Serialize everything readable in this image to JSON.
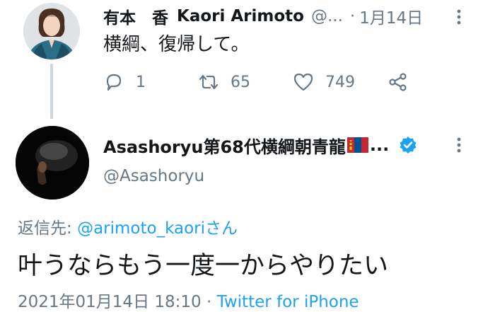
{
  "parent_tweet": {
    "avatar_icon": "profile-photo-woman",
    "display_name": "有本　香",
    "display_name_latin": "Kaori Arimoto",
    "handle": "@...",
    "separator": "·",
    "date": "1月14日",
    "text": "横綱、復帰して。",
    "actions": {
      "reply_count": "1",
      "retweet_count": "65",
      "like_count": "749"
    },
    "icons": {
      "reply": "reply-icon",
      "retweet": "retweet-icon",
      "like": "heart-icon",
      "share": "share-icon",
      "more": "more-vertical-icon"
    }
  },
  "reply_tweet": {
    "avatar_icon": "profile-photo-dark",
    "display_name": "Asashoryu第68代横綱朝青龍",
    "flag_icon": "mongolia-flag-icon",
    "name_ellipsis": "...",
    "verified_icon": "verified-badge-icon",
    "handle": "@Asashoryu",
    "reply_to_label": "返信先: ",
    "reply_to_mention": "@arimoto_kaori",
    "reply_to_suffix": "さん",
    "text": "叶うならもう一度一からやりたい",
    "timestamp": "2021年01月14日 18:10",
    "meta_separator": " · ",
    "source": "Twitter for iPhone"
  },
  "colors": {
    "text": "#14171a",
    "muted": "#657786",
    "link": "#1da1f2",
    "thread_line": "#ccd6dd",
    "verified": "#1da1f2"
  }
}
